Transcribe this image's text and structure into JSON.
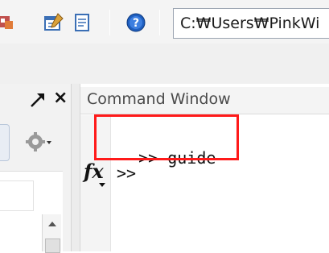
{
  "toolbar": {
    "icons": [
      {
        "name": "simulink-icon",
        "color": "#c0504d"
      },
      {
        "name": "guide-icon",
        "color": "#3b6fb5"
      },
      {
        "name": "editor-icon",
        "color": "#3b6fb5"
      },
      {
        "name": "help-icon",
        "color": "#1f5fbf"
      }
    ],
    "current_folder_path": "C:₩Users₩PinkWi"
  },
  "left_panel": {
    "undock_icon": "undock-arrow-icon",
    "close_symbol": "×",
    "settings_icon": "gear-dropdown-icon"
  },
  "command_window": {
    "title": "Command Window",
    "lines": [
      {
        "prompt": ">>",
        "text": "guide"
      }
    ],
    "current_prompt": ">>",
    "fx_label": "fx",
    "highlight_color": "#ff1a1a"
  }
}
